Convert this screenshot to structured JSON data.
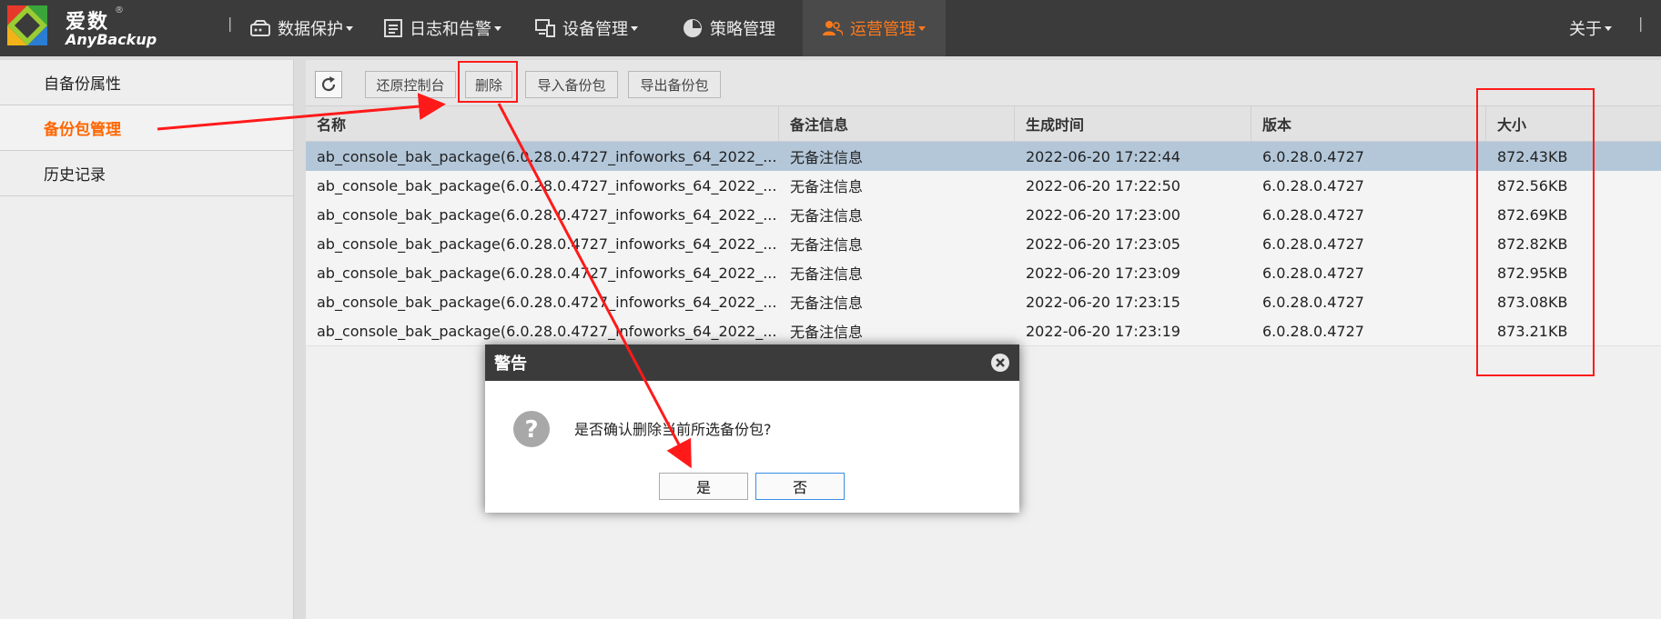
{
  "app": {
    "logo_cn": "爱数",
    "logo_en": "AnyBackup",
    "registered_mark": "®"
  },
  "nav": {
    "items": [
      {
        "label": "数据保护",
        "icon": "hdd-icon",
        "dropdown": true
      },
      {
        "label": "日志和告警",
        "icon": "document-icon",
        "dropdown": true
      },
      {
        "label": "设备管理",
        "icon": "devices-icon",
        "dropdown": true
      },
      {
        "label": "策略管理",
        "icon": "pie-clock-icon",
        "dropdown": false
      },
      {
        "label": "运营管理",
        "icon": "users-icon",
        "dropdown": true,
        "active": true
      }
    ],
    "about": "关于"
  },
  "sidebar": {
    "items": [
      {
        "label": "自备份属性",
        "active": false
      },
      {
        "label": "备份包管理",
        "active": true
      },
      {
        "label": "历史记录",
        "active": false
      }
    ]
  },
  "toolbar": {
    "refresh": "refresh",
    "buttons": [
      "还原控制台",
      "删除",
      "导入备份包",
      "导出备份包"
    ]
  },
  "table": {
    "columns": [
      "名称",
      "备注信息",
      "生成时间",
      "版本",
      "大小"
    ],
    "rows": [
      [
        "ab_console_bak_package(6.0.28.0.4727_infoworks_64_2022_...",
        "无备注信息",
        "2022-06-20 17:22:44",
        "6.0.28.0.4727",
        "872.43KB"
      ],
      [
        "ab_console_bak_package(6.0.28.0.4727_infoworks_64_2022_...",
        "无备注信息",
        "2022-06-20 17:22:50",
        "6.0.28.0.4727",
        "872.56KB"
      ],
      [
        "ab_console_bak_package(6.0.28.0.4727_infoworks_64_2022_...",
        "无备注信息",
        "2022-06-20 17:23:00",
        "6.0.28.0.4727",
        "872.69KB"
      ],
      [
        "ab_console_bak_package(6.0.28.0.4727_infoworks_64_2022_...",
        "无备注信息",
        "2022-06-20 17:23:05",
        "6.0.28.0.4727",
        "872.82KB"
      ],
      [
        "ab_console_bak_package(6.0.28.0.4727_infoworks_64_2022_...",
        "无备注信息",
        "2022-06-20 17:23:09",
        "6.0.28.0.4727",
        "872.95KB"
      ],
      [
        "ab_console_bak_package(6.0.28.0.4727_infoworks_64_2022_...",
        "无备注信息",
        "2022-06-20 17:23:15",
        "6.0.28.0.4727",
        "873.08KB"
      ],
      [
        "ab_console_bak_package(6.0.28.0.4727_infoworks_64_2022_...",
        "无备注信息",
        "2022-06-20 17:23:19",
        "6.0.28.0.4727",
        "873.21KB"
      ]
    ],
    "selected_row": 0
  },
  "dialog": {
    "title": "警告",
    "message": "是否确认删除当前所选备份包?",
    "yes": "是",
    "no": "否"
  },
  "colors": {
    "accent": "#ff6600",
    "annotation": "#ff1a1a",
    "selected_row": "#b3c7d9",
    "topbar": "#3b3b3b"
  }
}
